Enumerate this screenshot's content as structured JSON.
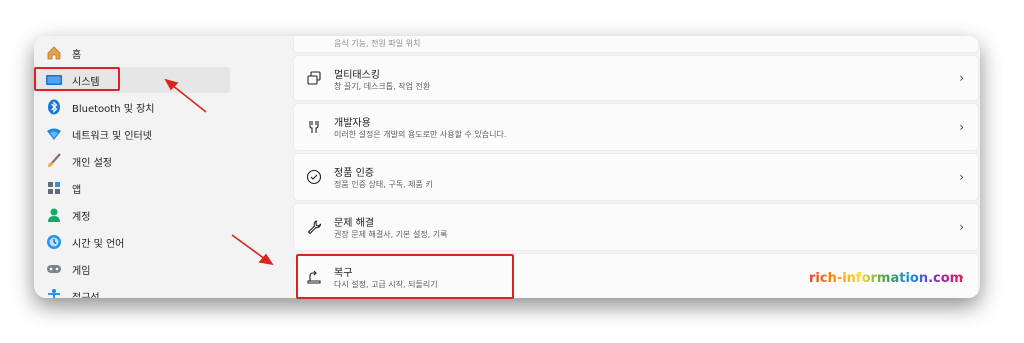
{
  "sidebar": {
    "items": [
      {
        "label": "홈",
        "icon": "home-icon"
      },
      {
        "label": "시스템",
        "icon": "system-icon"
      },
      {
        "label": "Bluetooth 및 장치",
        "icon": "bluetooth-icon"
      },
      {
        "label": "네트워크 및 인터넷",
        "icon": "network-icon"
      },
      {
        "label": "개인 설정",
        "icon": "brush-icon"
      },
      {
        "label": "앱",
        "icon": "apps-icon"
      },
      {
        "label": "계정",
        "icon": "account-icon"
      },
      {
        "label": "시간 및 언어",
        "icon": "time-language-icon"
      },
      {
        "label": "게임",
        "icon": "gaming-icon"
      },
      {
        "label": "접근성",
        "icon": "accessibility-icon"
      }
    ],
    "selected": "시스템"
  },
  "cards": {
    "top_partial": {
      "subtitle": "음식 기능, 전원 파일 위치"
    },
    "multitasking": {
      "title": "멀티태스킹",
      "subtitle": "창 끌기, 데스크톱, 작업 전환",
      "icon": "multitasking-icon"
    },
    "developer": {
      "title": "개발자용",
      "subtitle": "이러한 설정은 개발의 용도로만 사용할 수 있습니다.",
      "icon": "developer-icon"
    },
    "activation": {
      "title": "정품 인증",
      "subtitle": "정품 인증 상태, 구독, 제품 키",
      "icon": "check-circle-icon"
    },
    "troubleshoot": {
      "title": "문제 해결",
      "subtitle": "권장 문제 해결사, 기본 설정, 기록",
      "icon": "wrench-icon"
    },
    "recovery": {
      "title": "복구",
      "subtitle": "다시 설정, 고급 시작, 되돌리기",
      "icon": "recovery-icon"
    }
  },
  "chevron": "›",
  "watermark": "rich-information.com",
  "colors": {
    "highlight": "#d9251d",
    "accent": "#0067c0"
  }
}
